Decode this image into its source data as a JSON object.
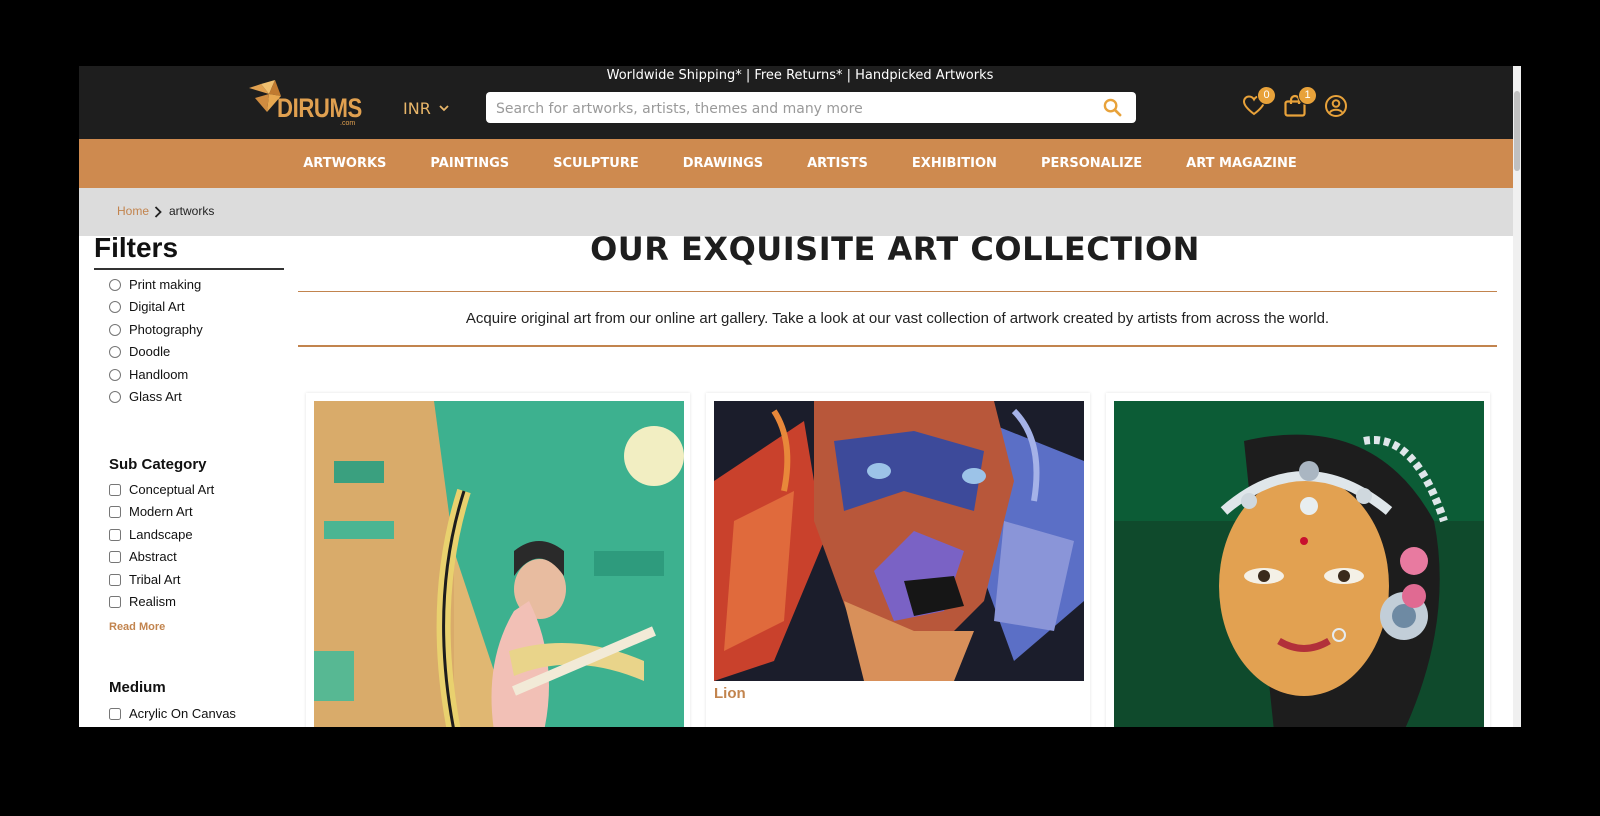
{
  "promo": "Worldwide Shipping* | Free Returns* | Handpicked Artworks",
  "brand": {
    "name": "DIRUMS",
    "suffix": ".com"
  },
  "currency": "INR",
  "search": {
    "placeholder": "Search for artworks, artists, themes and many more"
  },
  "header": {
    "wishlist_count": "0",
    "cart_count": "1"
  },
  "nav": [
    "ARTWORKS",
    "PAINTINGS",
    "SCULPTURE",
    "DRAWINGS",
    "ARTISTS",
    "EXHIBITION",
    "PERSONALIZE",
    "ART MAGAZINE"
  ],
  "breadcrumb": {
    "home": "Home",
    "current": "artworks"
  },
  "filters": {
    "title": "Filters",
    "categories": [
      "Print making",
      "Digital Art",
      "Photography",
      "Doodle",
      "Handloom",
      "Glass Art"
    ],
    "sub_category_title": "Sub Category",
    "sub_categories": [
      "Conceptual Art",
      "Modern Art",
      "Landscape",
      "Abstract",
      "Tribal Art",
      "Realism"
    ],
    "read_more": "Read More",
    "medium_title": "Medium",
    "mediums": [
      "Acrylic On Canvas"
    ]
  },
  "main": {
    "title": "OUR EXQUISITE ART COLLECTION",
    "intro": "Acquire original art from our online art gallery. Take a look at our vast collection of artwork created by artists from across the world."
  },
  "products": [
    {
      "title": ""
    },
    {
      "title": "Lion"
    },
    {
      "title": ""
    }
  ],
  "colors": {
    "accent": "#ce8a4f",
    "header_bg": "#1e1e1e",
    "badge": "#e8a23a"
  }
}
